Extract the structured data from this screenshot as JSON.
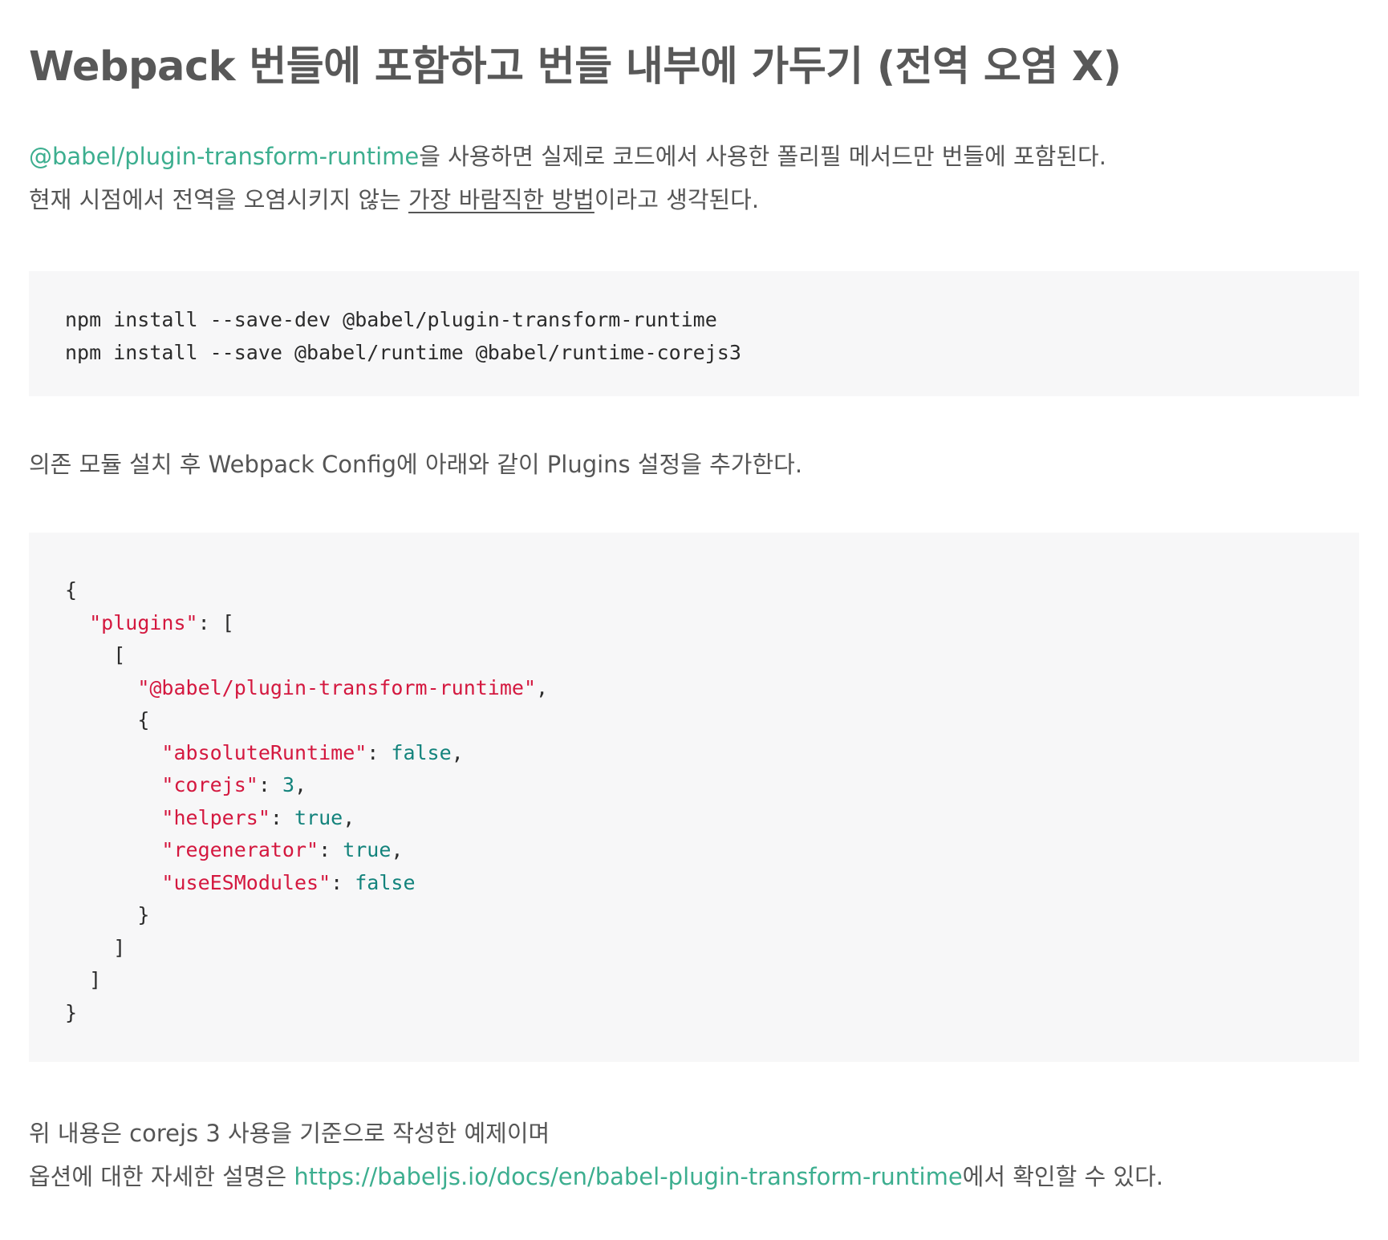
{
  "heading": "Webpack 번들에 포함하고 번들 내부에 가두기 (전역 오염 X)",
  "intro": {
    "link_text": "@babel/plugin-transform-runtime",
    "line1_rest": "을 사용하면 실제로 코드에서 사용한 폴리필 메서드만 번들에 포함된다.",
    "line2_before": "현재 시점에서 전역을 오염시키지 않는 ",
    "line2_underlined": "가장 바람직한 방법",
    "line2_after": "이라고 생각된다."
  },
  "install_code": {
    "lines": [
      "npm install --save-dev @babel/plugin-transform-runtime",
      "npm install --save @babel/runtime @babel/runtime-corejs3"
    ]
  },
  "config_intro": "의존 모듈 설치 후 Webpack Config에 아래와 같이 Plugins 설정을 추가한다.",
  "config_code": {
    "open_brace": "{",
    "plugins_key": "\"plugins\"",
    "colon": ": ",
    "open_bracket": "[",
    "inner_open_bracket": "[",
    "plugin_name": "\"@babel/plugin-transform-runtime\"",
    "comma": ",",
    "options_open": "{",
    "options": [
      {
        "key": "\"absoluteRuntime\"",
        "value": "false",
        "trailing": ","
      },
      {
        "key": "\"corejs\"",
        "value": "3",
        "trailing": ","
      },
      {
        "key": "\"helpers\"",
        "value": "true",
        "trailing": ","
      },
      {
        "key": "\"regenerator\"",
        "value": "true",
        "trailing": ","
      },
      {
        "key": "\"useESModules\"",
        "value": "false",
        "trailing": ""
      }
    ],
    "options_close": "}",
    "inner_close_bracket": "]",
    "close_bracket": "]",
    "close_brace": "}"
  },
  "outro": {
    "line1": "위 내용은 corejs 3 사용을 기준으로 작성한 예제이며",
    "line2_before": "옵션에 대한 자세한 설명은 ",
    "line2_link": "https://babeljs.io/docs/en/babel-plugin-transform-runtime",
    "line2_after": "에서 확인할 수 있다."
  },
  "colors": {
    "text": "#555555",
    "link": "#3cae8f",
    "code_bg": "#f7f7f8",
    "code_string": "#d4183f",
    "code_literal": "#13837c"
  }
}
